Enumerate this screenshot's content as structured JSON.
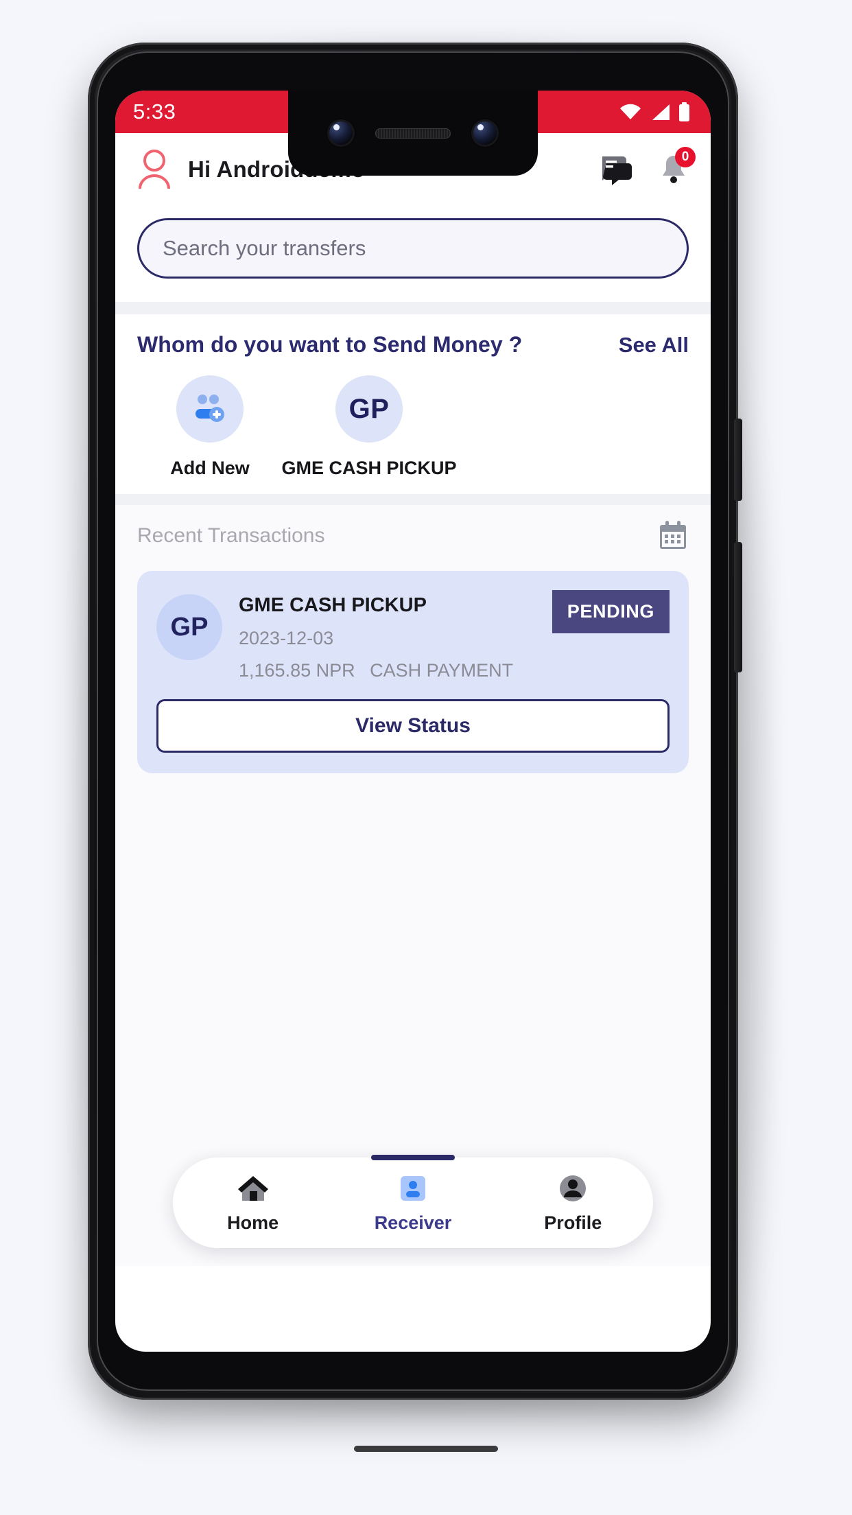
{
  "status_bar": {
    "time": "5:33",
    "icons": [
      "wifi-icon",
      "signal-icon",
      "battery-icon"
    ],
    "background_color": "#e01933"
  },
  "header": {
    "avatar_icon": "person-outline-icon",
    "greeting": "Hi Androiddemo",
    "chat_icon": "chat-bubble-icon",
    "notification_icon": "bell-icon",
    "notification_count": "0",
    "badge_color": "#e8112d"
  },
  "search": {
    "placeholder": "Search your transfers",
    "value": "",
    "border_color": "#2b2a66"
  },
  "send_money": {
    "title": "Whom do you want to Send Money ?",
    "see_all_label": "See All",
    "accent_color": "#2b2a6e",
    "contacts": [
      {
        "type": "add",
        "icon": "add-person-icon",
        "initials": "",
        "label": "Add New"
      },
      {
        "type": "receiver",
        "icon": "",
        "initials": "GP",
        "label": "GME CASH PICKUP"
      }
    ]
  },
  "recent": {
    "title": "Recent Transactions",
    "calendar_icon": "calendar-icon",
    "transactions": [
      {
        "initials": "GP",
        "name": "GME CASH PICKUP",
        "date": "2023-12-03",
        "amount": "1,165.85 NPR",
        "method": "CASH PAYMENT",
        "status": "PENDING",
        "status_color": "#4a4680",
        "action_label": "View Status"
      }
    ]
  },
  "bottom_nav": {
    "items": [
      {
        "label": "Home",
        "icon": "home-icon",
        "active": false
      },
      {
        "label": "Receiver",
        "icon": "receiver-person-icon",
        "active": true
      },
      {
        "label": "Profile",
        "icon": "profile-person-icon",
        "active": false
      }
    ],
    "active_color": "#3b3a8c"
  }
}
